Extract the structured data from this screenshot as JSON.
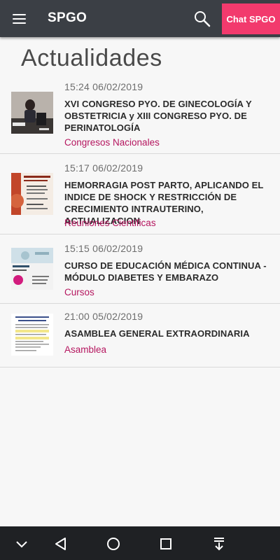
{
  "header": {
    "title": "SPGO",
    "chat_label": "Chat SPGO",
    "menu_icon": "hamburger-menu-icon",
    "search_icon": "search-icon",
    "bg_color": "#3b3f45",
    "chat_color": "#f23a6d"
  },
  "page": {
    "title": "Actualidades"
  },
  "news": [
    {
      "time": "15:24 06/02/2019",
      "title": "XVI CONGRESO PYO. DE GINECOLOGÍA Y OBSTETRICIA y XIII CONGRESO PYO. DE PERINATOLOGÍA",
      "category": "Congresos Nacionales"
    },
    {
      "time": "15:17 06/02/2019",
      "title": "HEMORRAGIA POST PARTO, APLICANDO EL INDICE DE SHOCK Y RESTRICCIÓN DE CRECIMIENTO INTRAUTERINO, ACTUALIZACION",
      "category": "Reuniones Cientificas"
    },
    {
      "time": "15:15 06/02/2019",
      "title": "CURSO DE EDUCACIÓN MÉDICA CONTINUA - MÓDULO DIABETES Y EMBARAZO",
      "category": "Cursos"
    },
    {
      "time": "21:00 05/02/2019",
      "title": "ASAMBLEA GENERAL EXTRAORDINARIA",
      "category": "Asamblea"
    }
  ],
  "category_color": "#b5165f",
  "system_nav": {
    "icons": [
      "collapse-chevron-icon",
      "back-icon",
      "home-icon",
      "recents-icon",
      "notification-pull-icon"
    ]
  }
}
